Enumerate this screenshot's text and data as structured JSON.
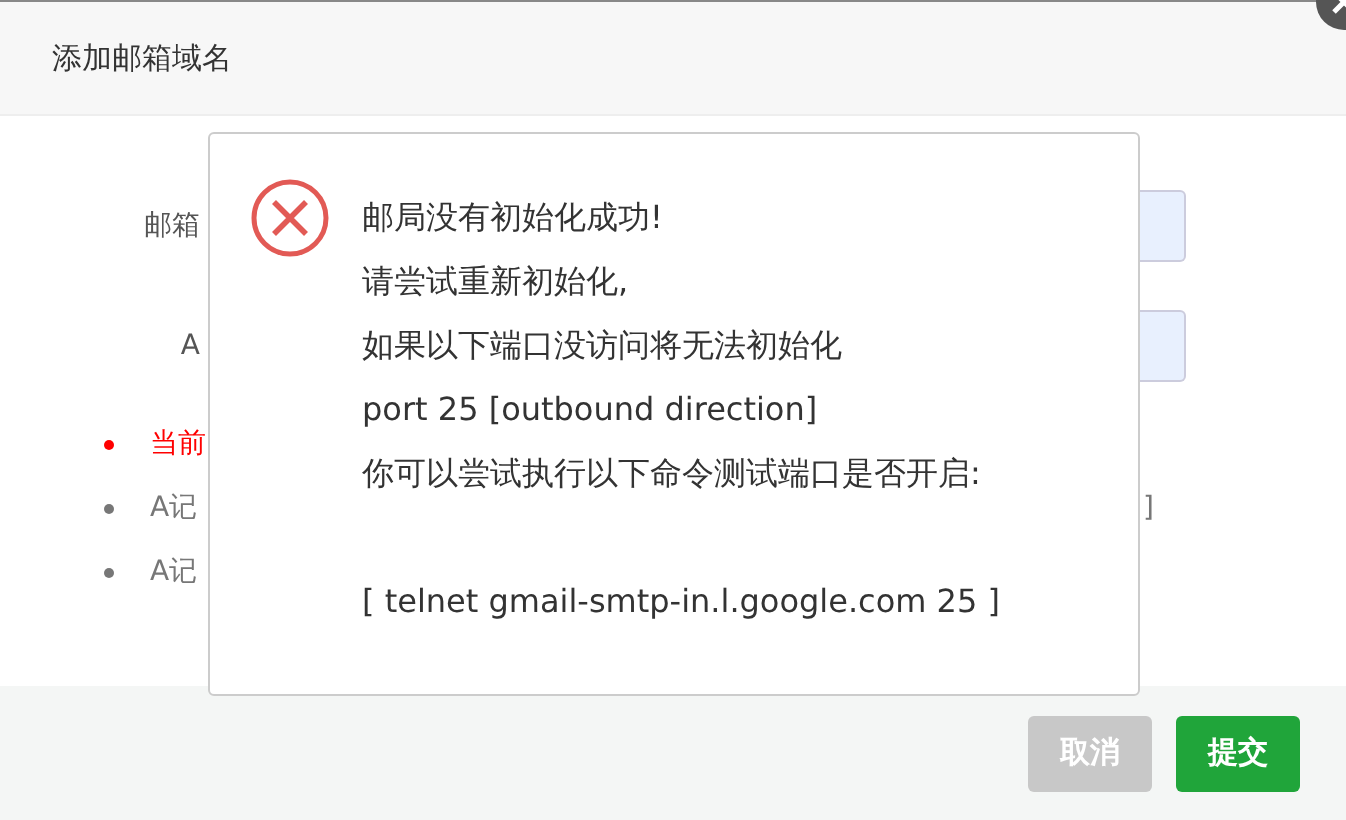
{
  "dialog": {
    "title": "添加邮箱域名"
  },
  "form": {
    "fields": [
      {
        "label": "邮箱"
      },
      {
        "label": "A"
      }
    ],
    "notes": [
      {
        "text": "当前",
        "kind": "warning"
      },
      {
        "text": "A记",
        "kind": "info",
        "tail": "]"
      },
      {
        "text": "A记",
        "kind": "info"
      }
    ]
  },
  "alert": {
    "lines": [
      "邮局没有初始化成功!",
      "请尝试重新初始化,",
      "如果以下端口没访问将无法初始化",
      "port 25 [outbound direction]",
      "你可以尝试执行以下命令测试端口是否开启:"
    ],
    "command": "[ telnet gmail-smtp-in.l.google.com 25 ]"
  },
  "buttons": [
    {
      "label": "取消",
      "kind": "cancel"
    },
    {
      "label": "提交",
      "kind": "primary"
    }
  ]
}
